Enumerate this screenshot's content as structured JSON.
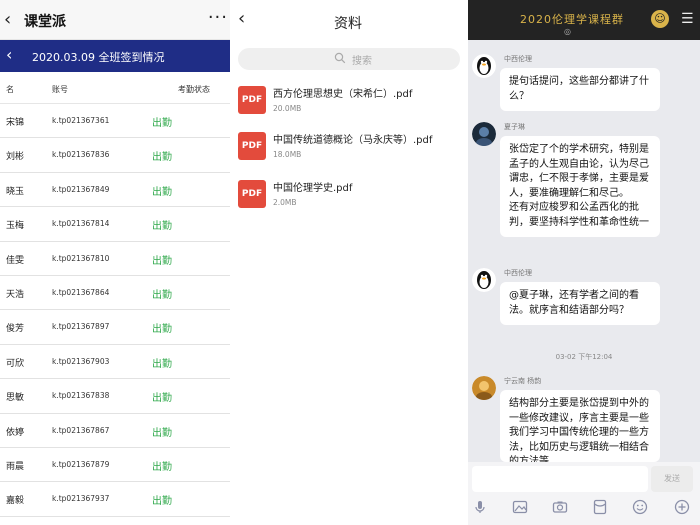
{
  "attendance": {
    "title": "课堂派",
    "banner_title": "2020.03.09 全班签到情况",
    "columns": {
      "name": "名",
      "account": "账号",
      "status": "考勤状态"
    },
    "rows": [
      {
        "name": "宋锦",
        "account": "k.tp021367361",
        "status": "出勤"
      },
      {
        "name": "刘彬",
        "account": "k.tp021367836",
        "status": "出勤"
      },
      {
        "name": "晓玉",
        "account": "k.tp021367849",
        "status": "出勤"
      },
      {
        "name": "玉梅",
        "account": "k.tp021367814",
        "status": "出勤"
      },
      {
        "name": "佳雯",
        "account": "k.tp021367810",
        "status": "出勤"
      },
      {
        "name": "天浩",
        "account": "k.tp021367864",
        "status": "出勤"
      },
      {
        "name": "俊芳",
        "account": "k.tp021367897",
        "status": "出勤"
      },
      {
        "name": "可欣",
        "account": "k.tp021367903",
        "status": "出勤"
      },
      {
        "name": "思敏",
        "account": "k.tp021367838",
        "status": "出勤"
      },
      {
        "name": "依婷",
        "account": "k.tp021367867",
        "status": "出勤"
      },
      {
        "name": "雨晨",
        "account": "k.tp021367879",
        "status": "出勤"
      },
      {
        "name": "嘉毅",
        "account": "k.tp021367937",
        "status": "出勤"
      }
    ]
  },
  "materials": {
    "title": "资料",
    "search_placeholder": "搜索",
    "files": [
      {
        "name": "西方伦理思想史（宋希仁）.pdf",
        "size": "20.0MB",
        "badge": "PDF"
      },
      {
        "name": "中国传统道德概论（马永庆等）.pdf",
        "size": "18.0MB",
        "badge": "PDF"
      },
      {
        "name": "中国伦理学史.pdf",
        "size": "2.0MB",
        "badge": "PDF"
      }
    ]
  },
  "chat": {
    "title": "2020伦理学课程群",
    "subtitle": "◎",
    "messages": [
      {
        "sender": "中西伦理",
        "text": "提句话提问，这些部分都讲了什么？"
      },
      {
        "sender": "夏子琳",
        "text": "张岱定了个的学术研究，特别是孟子的人生观自由论，认为尽己谓忠，仁不限于孝悌，主要是爱人，要准确理解仁和尽己。\n还有对应梭罗和公孟西化的批判，要坚持科学性和革命性统一"
      },
      {
        "sender": "中西伦理",
        "text": "@夏子琳，还有学者之间的看法。就序言和结语部分吗？"
      },
      {
        "sender": "宁云南 杨韵",
        "text": "结构部分主要是张岱提到中外的一些修改建议，序言主要是一些我们学习中国传统伦理的一些方法，比如历史与逻辑统一相结合的方法等"
      }
    ],
    "divider": "03-02 下午12:04",
    "send_label": "发送"
  }
}
